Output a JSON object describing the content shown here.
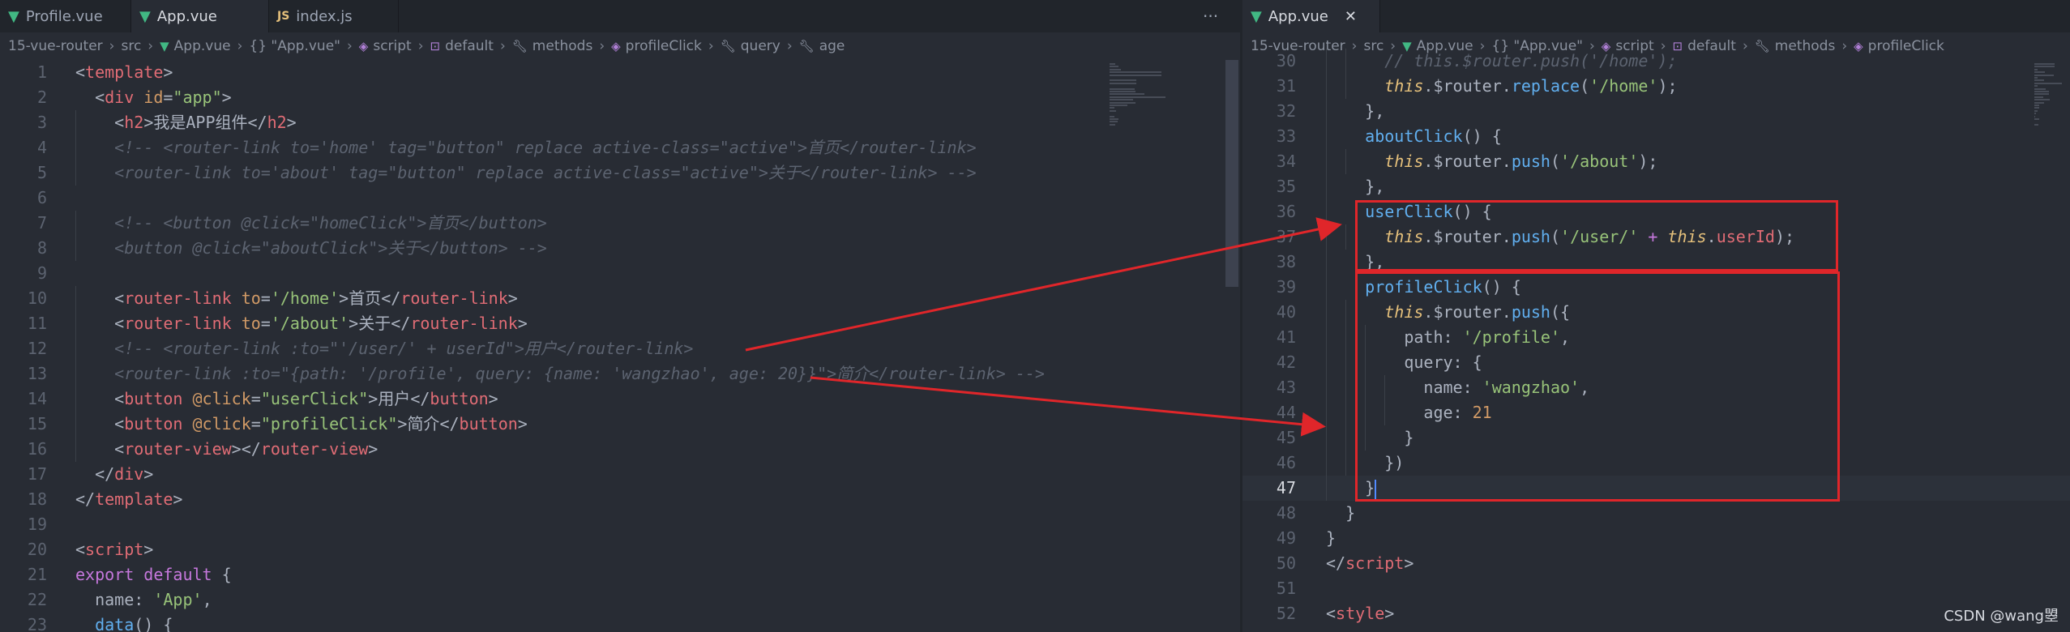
{
  "left": {
    "tabs": [
      {
        "label": "Profile.vue",
        "icon": "vue-icon"
      },
      {
        "label": "App.vue",
        "icon": "vue-icon"
      },
      {
        "label": "index.js",
        "icon": "js-icon",
        "badge": "JS"
      }
    ],
    "more": "···",
    "breadcrumb": [
      "15-vue-router",
      "src",
      "App.vue",
      "{} \"App.vue\"",
      "script",
      "default",
      "methods",
      "profileClick",
      "query",
      "age"
    ],
    "lines": [
      {
        "n": "1",
        "tokens": [
          [
            "p",
            "<"
          ],
          [
            "t",
            "template"
          ],
          [
            "p",
            ">"
          ]
        ]
      },
      {
        "n": "2",
        "tokens": [
          [
            "p",
            "  <"
          ],
          [
            "t",
            "div"
          ],
          [
            "a",
            " id"
          ],
          [
            "p",
            "="
          ],
          [
            "s",
            "\"app\""
          ],
          [
            "p",
            ">"
          ]
        ]
      },
      {
        "n": "3",
        "tokens": [
          [
            "p",
            "    <"
          ],
          [
            "t",
            "h2"
          ],
          [
            "p",
            ">"
          ],
          [
            "pl",
            "我是APP组件"
          ],
          [
            "p",
            "</"
          ],
          [
            "t",
            "h2"
          ],
          [
            "p",
            ">"
          ]
        ]
      },
      {
        "n": "4",
        "tokens": [
          [
            "c",
            "    <!-- <router-link to='home' tag=\"button\" replace active-class=\"active\">首页</router-link>"
          ]
        ]
      },
      {
        "n": "5",
        "tokens": [
          [
            "c",
            "    <router-link to='about' tag=\"button\" replace active-class=\"active\">关于</router-link> -->"
          ]
        ]
      },
      {
        "n": "6",
        "tokens": []
      },
      {
        "n": "7",
        "tokens": [
          [
            "c",
            "    <!-- <button @click=\"homeClick\">首页</button>"
          ]
        ]
      },
      {
        "n": "8",
        "tokens": [
          [
            "c",
            "    <button @click=\"aboutClick\">关于</button> -->"
          ]
        ]
      },
      {
        "n": "9",
        "tokens": []
      },
      {
        "n": "10",
        "tokens": [
          [
            "p",
            "    <"
          ],
          [
            "t",
            "router-link"
          ],
          [
            "a",
            " to"
          ],
          [
            "p",
            "="
          ],
          [
            "s",
            "'/home'"
          ],
          [
            "p",
            ">"
          ],
          [
            "pl",
            "首页"
          ],
          [
            "p",
            "</"
          ],
          [
            "t",
            "router-link"
          ],
          [
            "p",
            ">"
          ]
        ]
      },
      {
        "n": "11",
        "tokens": [
          [
            "p",
            "    <"
          ],
          [
            "t",
            "router-link"
          ],
          [
            "a",
            " to"
          ],
          [
            "p",
            "="
          ],
          [
            "s",
            "'/about'"
          ],
          [
            "p",
            ">"
          ],
          [
            "pl",
            "关于"
          ],
          [
            "p",
            "</"
          ],
          [
            "t",
            "router-link"
          ],
          [
            "p",
            ">"
          ]
        ]
      },
      {
        "n": "12",
        "tokens": [
          [
            "c",
            "    <!-- <router-link :to=\"'/user/' + userId\">用户</router-link>"
          ]
        ]
      },
      {
        "n": "13",
        "tokens": [
          [
            "c",
            "    <router-link :to=\"{path: '/profile', query: {name: 'wangzhao', age: 20}}\">简介</router-link> -->"
          ]
        ]
      },
      {
        "n": "14",
        "tokens": [
          [
            "p",
            "    <"
          ],
          [
            "t",
            "button"
          ],
          [
            "a",
            " @click"
          ],
          [
            "p",
            "="
          ],
          [
            "s",
            "\"userClick\""
          ],
          [
            "p",
            ">"
          ],
          [
            "pl",
            "用户"
          ],
          [
            "p",
            "</"
          ],
          [
            "t",
            "button"
          ],
          [
            "p",
            ">"
          ]
        ]
      },
      {
        "n": "15",
        "tokens": [
          [
            "p",
            "    <"
          ],
          [
            "t",
            "button"
          ],
          [
            "a",
            " @click"
          ],
          [
            "p",
            "="
          ],
          [
            "s",
            "\"profileClick\""
          ],
          [
            "p",
            ">"
          ],
          [
            "pl",
            "简介"
          ],
          [
            "p",
            "</"
          ],
          [
            "t",
            "button"
          ],
          [
            "p",
            ">"
          ]
        ]
      },
      {
        "n": "16",
        "tokens": [
          [
            "p",
            "    <"
          ],
          [
            "t",
            "router-view"
          ],
          [
            "p",
            "></"
          ],
          [
            "t",
            "router-view"
          ],
          [
            "p",
            ">"
          ]
        ]
      },
      {
        "n": "17",
        "tokens": [
          [
            "p",
            "  </"
          ],
          [
            "t",
            "div"
          ],
          [
            "p",
            ">"
          ]
        ]
      },
      {
        "n": "18",
        "tokens": [
          [
            "p",
            "</"
          ],
          [
            "t",
            "template"
          ],
          [
            "p",
            ">"
          ]
        ]
      },
      {
        "n": "19",
        "tokens": []
      },
      {
        "n": "20",
        "tokens": [
          [
            "p",
            "<"
          ],
          [
            "t",
            "script"
          ],
          [
            "p",
            ">"
          ]
        ]
      },
      {
        "n": "21",
        "tokens": [
          [
            "k",
            "export"
          ],
          [
            "pl",
            " "
          ],
          [
            "k",
            "default"
          ],
          [
            "pl",
            " {"
          ]
        ]
      },
      {
        "n": "22",
        "tokens": [
          [
            "pl",
            "  name"
          ],
          [
            "p",
            ": "
          ],
          [
            "s",
            "'App'"
          ],
          [
            "p",
            ","
          ]
        ]
      },
      {
        "n": "23",
        "tokens": [
          [
            "f",
            "  data"
          ],
          [
            "p",
            "() {"
          ]
        ]
      }
    ]
  },
  "right": {
    "tab": {
      "label": "App.vue",
      "icon": "vue-icon",
      "close": "✕"
    },
    "breadcrumb": [
      "15-vue-router",
      "src",
      "App.vue",
      "{} \"App.vue\"",
      "script",
      "default",
      "methods",
      "profileClick"
    ],
    "lines": [
      {
        "n": "30",
        "tokens": [
          [
            "c",
            "      // this.$router.push('/home');"
          ]
        ]
      },
      {
        "n": "31",
        "tokens": [
          [
            "v",
            "      this"
          ],
          [
            "pl",
            "."
          ],
          [
            "pl",
            "$router"
          ],
          [
            "pl",
            "."
          ],
          [
            "f",
            "replace"
          ],
          [
            "p",
            "("
          ],
          [
            "s",
            "'/home'"
          ],
          [
            "p",
            ");"
          ]
        ]
      },
      {
        "n": "32",
        "tokens": [
          [
            "p",
            "    },"
          ]
        ]
      },
      {
        "n": "33",
        "tokens": [
          [
            "f",
            "    aboutClick"
          ],
          [
            "p",
            "() {"
          ]
        ]
      },
      {
        "n": "34",
        "tokens": [
          [
            "v",
            "      this"
          ],
          [
            "pl",
            "."
          ],
          [
            "pl",
            "$router"
          ],
          [
            "pl",
            "."
          ],
          [
            "f",
            "push"
          ],
          [
            "p",
            "("
          ],
          [
            "s",
            "'/about'"
          ],
          [
            "p",
            ");"
          ]
        ]
      },
      {
        "n": "35",
        "tokens": [
          [
            "p",
            "    },"
          ]
        ]
      },
      {
        "n": "36",
        "tokens": [
          [
            "f",
            "    userClick"
          ],
          [
            "p",
            "() {"
          ]
        ]
      },
      {
        "n": "37",
        "tokens": [
          [
            "v",
            "      this"
          ],
          [
            "pl",
            "."
          ],
          [
            "pl",
            "$router"
          ],
          [
            "pl",
            "."
          ],
          [
            "f",
            "push"
          ],
          [
            "p",
            "("
          ],
          [
            "s",
            "'/user/'"
          ],
          [
            "pl",
            " "
          ],
          [
            "k",
            "+"
          ],
          [
            "pl",
            " "
          ],
          [
            "v",
            "this"
          ],
          [
            "pl",
            "."
          ],
          [
            "pr",
            "userId"
          ],
          [
            "p",
            ");"
          ]
        ]
      },
      {
        "n": "38",
        "tokens": [
          [
            "p",
            "    },"
          ]
        ]
      },
      {
        "n": "39",
        "tokens": [
          [
            "f",
            "    profileClick"
          ],
          [
            "p",
            "() {"
          ]
        ]
      },
      {
        "n": "40",
        "tokens": [
          [
            "v",
            "      this"
          ],
          [
            "pl",
            "."
          ],
          [
            "pl",
            "$router"
          ],
          [
            "pl",
            "."
          ],
          [
            "f",
            "push"
          ],
          [
            "p",
            "({"
          ]
        ]
      },
      {
        "n": "41",
        "tokens": [
          [
            "pl",
            "        path"
          ],
          [
            "p",
            ": "
          ],
          [
            "s",
            "'/profile'"
          ],
          [
            "p",
            ","
          ]
        ]
      },
      {
        "n": "42",
        "tokens": [
          [
            "pl",
            "        query"
          ],
          [
            "p",
            ": {"
          ]
        ]
      },
      {
        "n": "43",
        "tokens": [
          [
            "pl",
            "          name"
          ],
          [
            "p",
            ": "
          ],
          [
            "s",
            "'wangzhao'"
          ],
          [
            "p",
            ","
          ]
        ]
      },
      {
        "n": "44",
        "tokens": [
          [
            "pl",
            "          age"
          ],
          [
            "p",
            ": "
          ],
          [
            "n",
            "21"
          ]
        ]
      },
      {
        "n": "45",
        "tokens": [
          [
            "p",
            "        }"
          ]
        ]
      },
      {
        "n": "46",
        "tokens": [
          [
            "p",
            "      })"
          ]
        ]
      },
      {
        "n": "47",
        "tokens": [
          [
            "p",
            "    }"
          ]
        ],
        "current": true
      },
      {
        "n": "48",
        "tokens": [
          [
            "p",
            "  }"
          ]
        ]
      },
      {
        "n": "49",
        "tokens": [
          [
            "p",
            "}"
          ]
        ]
      },
      {
        "n": "50",
        "tokens": [
          [
            "p",
            "</"
          ],
          [
            "t",
            "script"
          ],
          [
            "p",
            ">"
          ]
        ]
      },
      {
        "n": "51",
        "tokens": []
      },
      {
        "n": "52",
        "tokens": [
          [
            "p",
            "<"
          ],
          [
            "t",
            "style"
          ],
          [
            "p",
            ">"
          ]
        ]
      }
    ]
  },
  "watermark": "CSDN @wang曌",
  "colors": {
    "annotation_red": "#e0262a",
    "editor_bg": "#282c34",
    "tab_bg": "#21252b"
  }
}
